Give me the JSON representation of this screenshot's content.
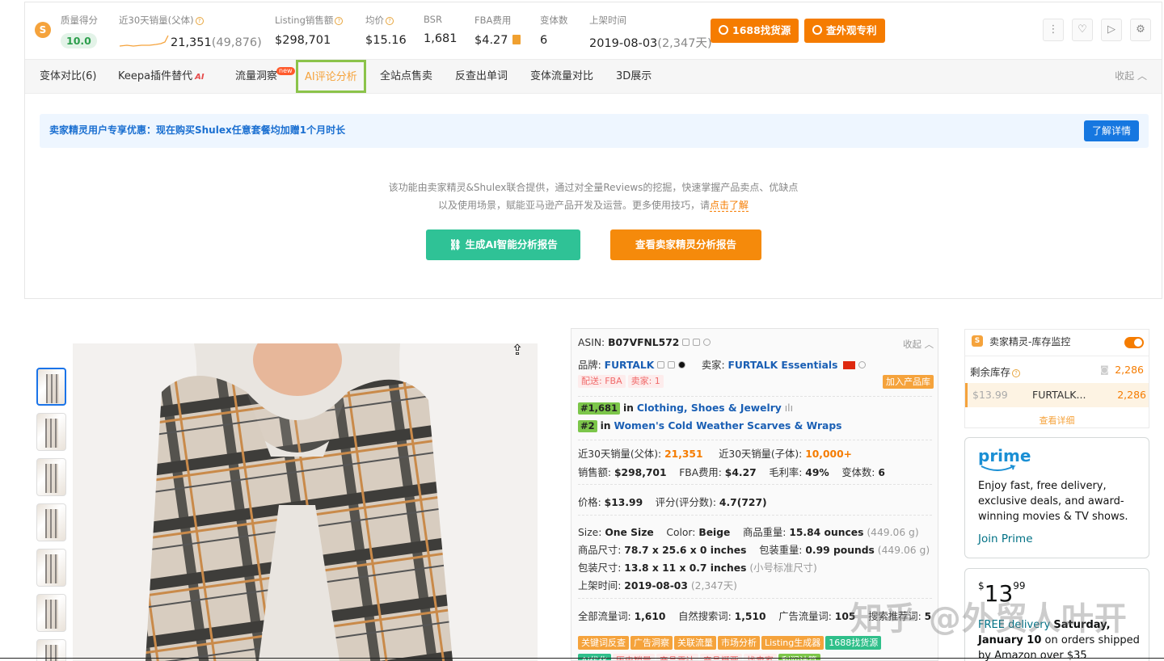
{
  "metrics": {
    "quality": {
      "label": "质量得分",
      "value": "10.0"
    },
    "sales30": {
      "label": "近30天销量(父体)",
      "value": "21,351",
      "extra": "(49,876)"
    },
    "listing_sales": {
      "label": "Listing销售额",
      "value": "$298,701"
    },
    "avg_price": {
      "label": "均价",
      "value": "$15.16"
    },
    "bsr": {
      "label": "BSR",
      "value": "1,681"
    },
    "fba": {
      "label": "FBA费用",
      "value": "$4.27"
    },
    "variants": {
      "label": "变体数",
      "value": "6"
    },
    "launch": {
      "label": "上架时间",
      "value": "2019-08-03",
      "extra": "(2,347天)"
    }
  },
  "buttons": {
    "find_source": "1688找货源",
    "check_patent": "查外观专利"
  },
  "tabs": [
    {
      "label": "变体对比(6)"
    },
    {
      "label": "Keepa插件替代",
      "badge": "AI"
    },
    {
      "label": "流量洞察",
      "badge": "new"
    },
    {
      "label": "AI评论分析"
    },
    {
      "label": "全站点售卖"
    },
    {
      "label": "反查出单词"
    },
    {
      "label": "变体流量对比"
    },
    {
      "label": "3D展示"
    }
  ],
  "collapse_label": "收起",
  "promo": {
    "text": "卖家精灵用户专享优惠：现在购买Shulex任意套餐均加赠1个月时长",
    "button": "了解详情"
  },
  "description": {
    "line1": "该功能由卖家精灵&Shulex联合提供，通过对全量Reviews的挖掘，快速掌握产品卖点、优缺点",
    "line2": "以及使用场景，赋能亚马逊产品开发及运营。更多使用技巧，请",
    "link": "点击了解"
  },
  "action_buttons": {
    "generate": "生成AI智能分析报告",
    "view": "查看卖家精灵分析报告"
  },
  "product": {
    "asin_label": "ASIN:",
    "asin": "B07VFNL572",
    "collapse": "收起",
    "brand_label": "品牌:",
    "brand": "FURTALK",
    "seller_label": "卖家:",
    "seller": "FURTALK Essentials",
    "delivery": "配送: FBA",
    "seller_count": "卖家: 1",
    "add_lib": "加入产品库",
    "rank1": "#1,681",
    "rank1_in": "in",
    "rank1_cat": "Clothing, Shoes & Jewelry",
    "rank2": "#2",
    "rank2_in": "in",
    "rank2_cat": "Women's Cold Weather Scarves & Wraps",
    "sales_parent_label": "近30天销量(父体):",
    "sales_parent": "21,351",
    "sales_child_label": "近30天销量(子体):",
    "sales_child": "10,000+",
    "revenue_label": "销售额:",
    "revenue": "$298,701",
    "fba_label": "FBA费用:",
    "fba": "$4.27",
    "margin_label": "毛利率:",
    "margin": "49%",
    "variants_label": "变体数:",
    "variants": "6",
    "price_label": "价格:",
    "price": "$13.99",
    "rating_label": "评分(评分数):",
    "rating": "4.7(727)",
    "size_label": "Size:",
    "size": "One Size",
    "color_label": "Color:",
    "color": "Beige",
    "weight_label": "商品重量:",
    "weight": "15.84 ounces",
    "weight_g": "(449.06 g)",
    "dim_label": "商品尺寸:",
    "dim": "78.7 x 25.6 x 0 inches",
    "pkg_weight_label": "包装重量:",
    "pkg_weight": "0.99 pounds",
    "pkg_weight_g": "(449.06 g)",
    "pkg_dim_label": "包装尺寸:",
    "pkg_dim": "13.8 x 11 x 0.7 inches",
    "pkg_dim_note": "(小号标准尺寸)",
    "launch_label": "上架时间:",
    "launch": "2019-08-03",
    "launch_days": "(2,347天)",
    "traffic_all_label": "全部流量词:",
    "traffic_all": "1,610",
    "traffic_natural_label": "自然搜索词:",
    "traffic_natural": "1,510",
    "traffic_ad_label": "广告流量词:",
    "traffic_ad": "105",
    "traffic_rec_label": "搜索推荐词:",
    "traffic_rec": "5"
  },
  "tool_chips": [
    {
      "label": "关键词反查",
      "color": "#f5a33c"
    },
    {
      "label": "广告洞察",
      "color": "#f5a33c"
    },
    {
      "label": "关联流量",
      "color": "#f5a33c"
    },
    {
      "label": "市场分析",
      "color": "#f5a33c"
    },
    {
      "label": "Listing生成器",
      "color": "#f5a33c"
    },
    {
      "label": "1688找货源",
      "color": "#2fbf8a"
    }
  ],
  "tool_chips_row2": [
    {
      "label": "AI优化",
      "color": "#2fbf8a"
    },
    {
      "label": "历史销量",
      "color": "#fdecec"
    },
    {
      "label": "产品雷达",
      "color": "#fdecec"
    },
    {
      "label": "产品概要",
      "color": "#fdecec"
    },
    {
      "label": "找卖家",
      "color": "#fdecec"
    },
    {
      "label": "利润计算",
      "color": "#7cc64a"
    }
  ],
  "inventory": {
    "title": "卖家精灵-库存监控",
    "remaining_label": "剩余库存",
    "remaining": "2,286",
    "row_price": "$13.99",
    "row_seller": "FURTALK...",
    "row_qty": "2,286",
    "more": "查看详细"
  },
  "prime": {
    "logo": "prime",
    "text": "Enjoy fast, free delivery, exclusive deals, and award-winning movies & TV shows.",
    "link": "Join Prime"
  },
  "buybox": {
    "currency": "$",
    "whole": "13",
    "fraction": "99",
    "free_label": "FREE delivery",
    "free_day": "Saturday,",
    "date": "January 10",
    "date_suffix": "on orders shipped",
    "by": "by Amazon over $35"
  },
  "watermark": "知乎 @外贸人叶开",
  "colors": {
    "accent_orange": "#f57c00",
    "green_btn": "#2fc296",
    "blue_link": "#1a5fb4",
    "active_border": "#8bc34a"
  }
}
